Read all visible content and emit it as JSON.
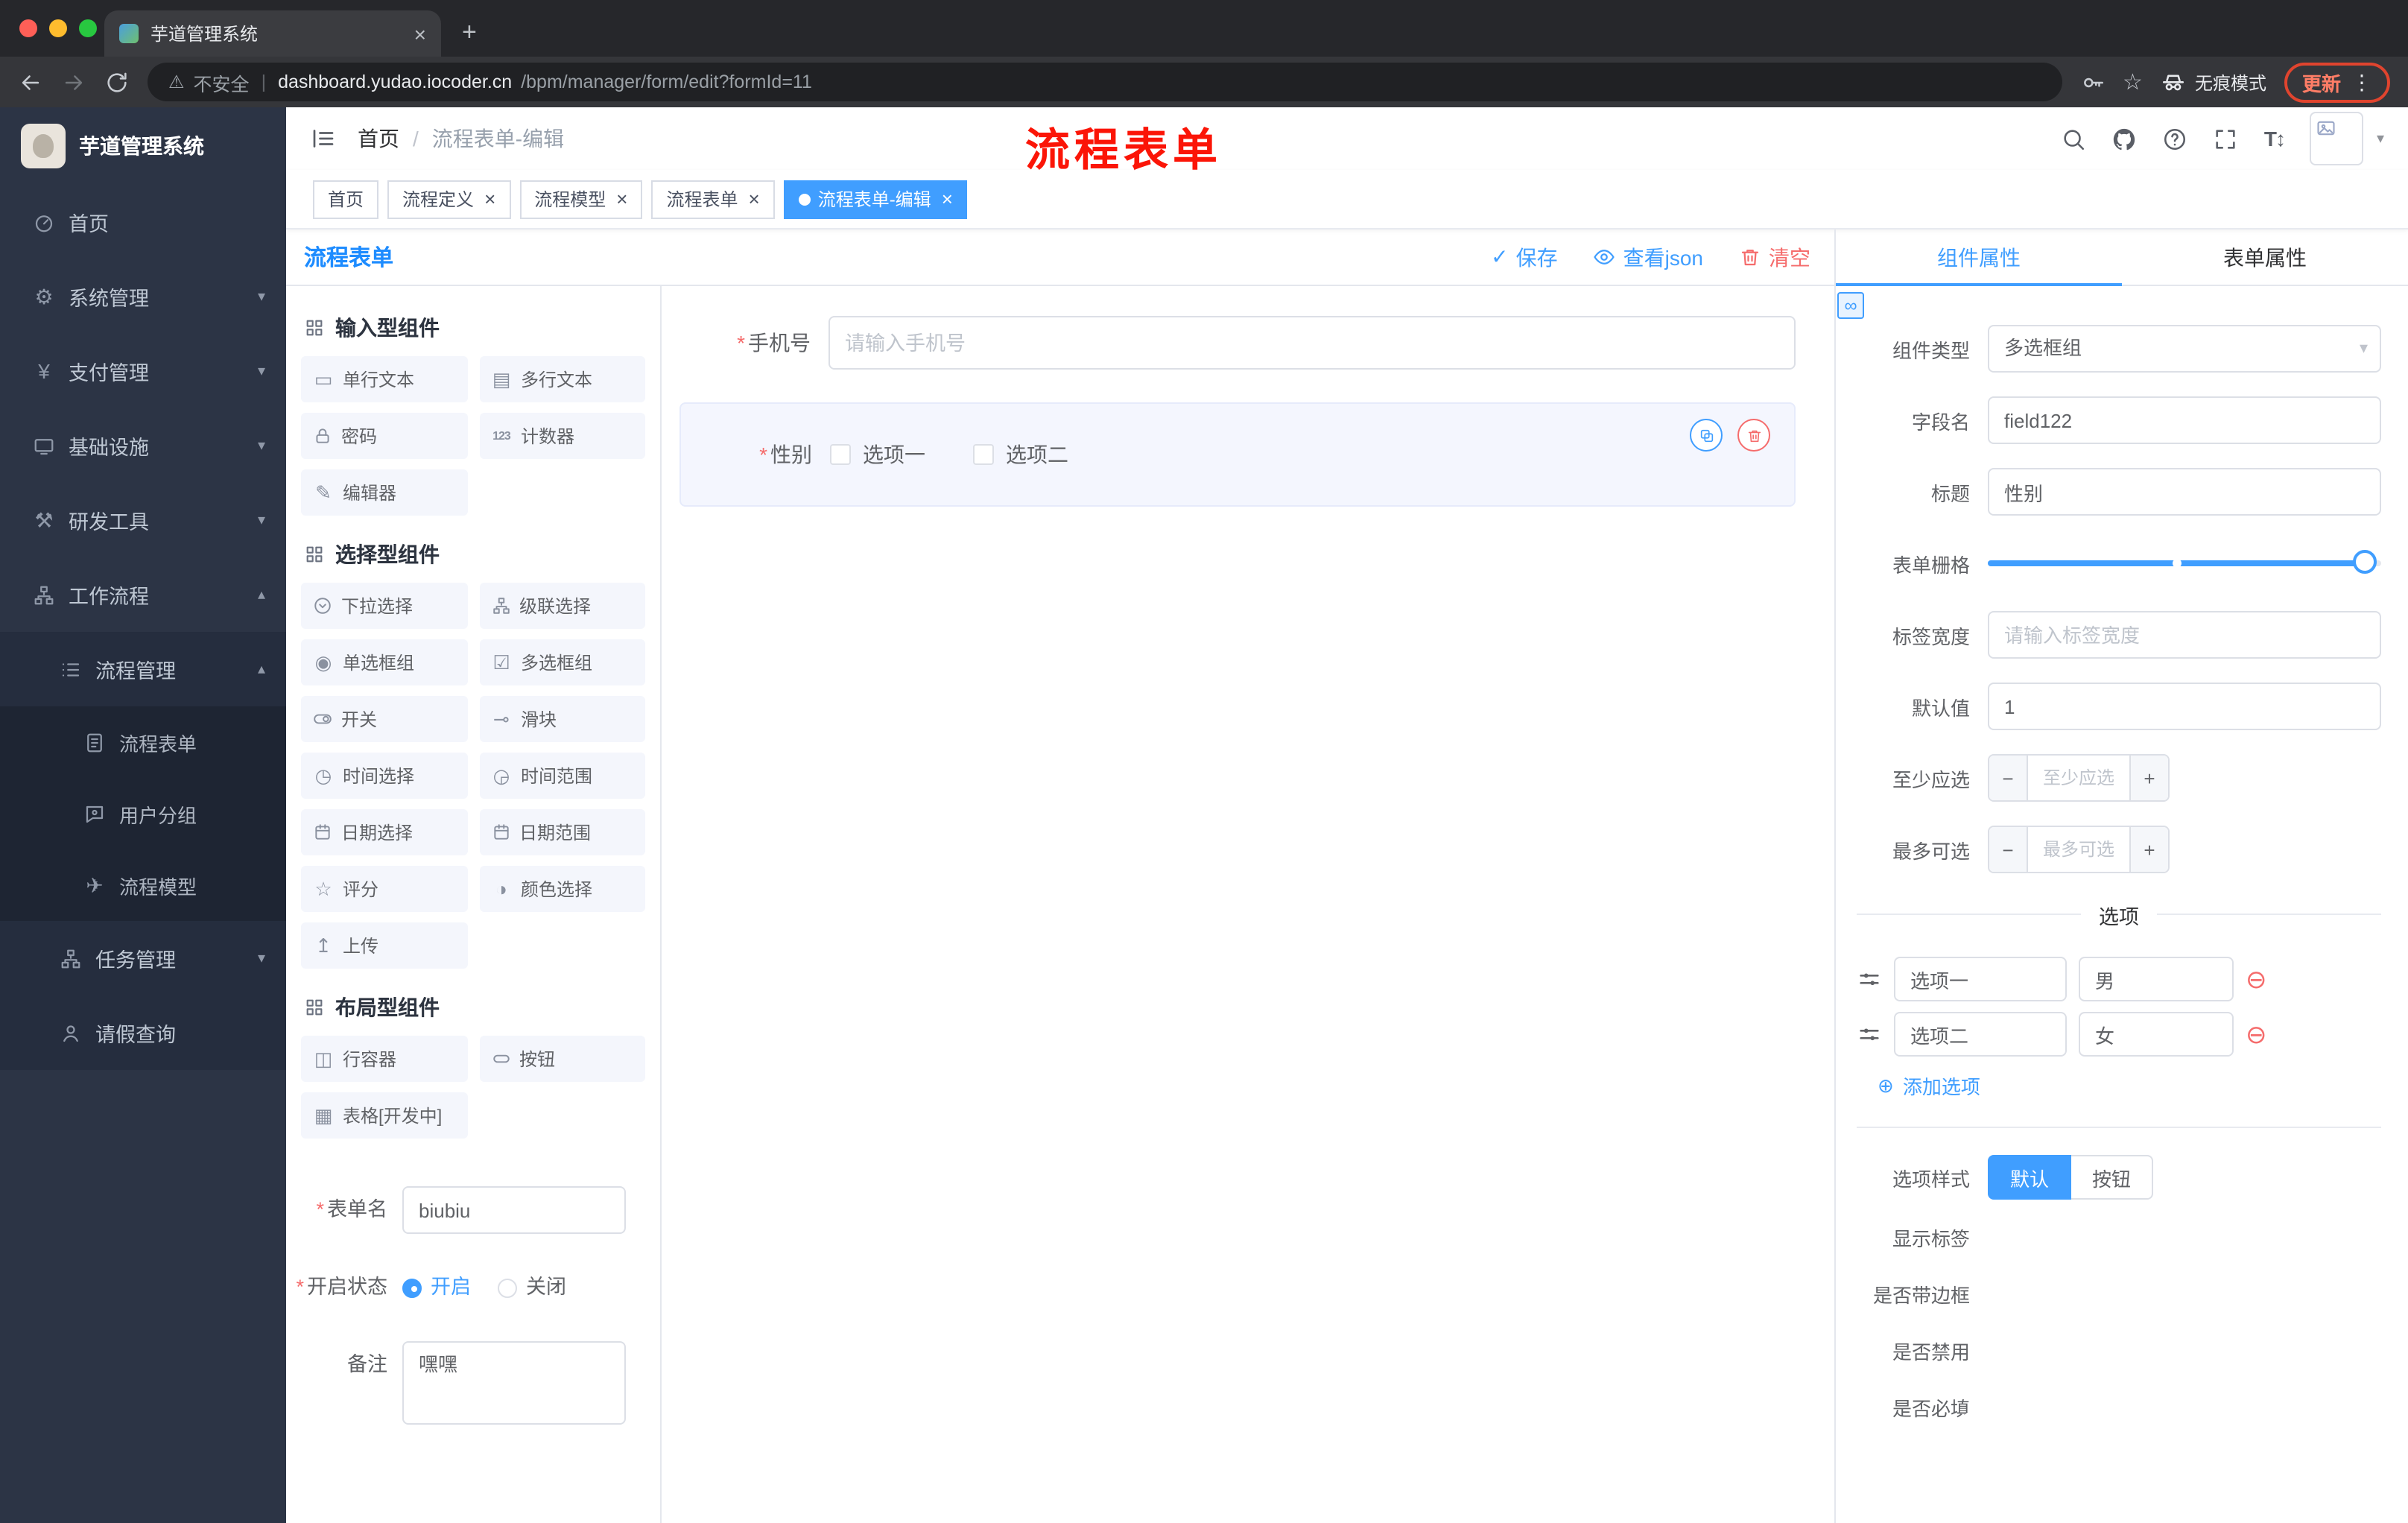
{
  "browser": {
    "tab_title": "芋道管理系统",
    "security_label": "不安全",
    "url_host": "dashboard.yudao.iocoder.cn",
    "url_path": "/bpm/manager/form/edit?formId=11",
    "incognito_label": "无痕模式",
    "update_label": "更新"
  },
  "annotation": {
    "overlay_title": "流程表单"
  },
  "icons": {
    "close": "×",
    "plus": "+",
    "more": "⋮",
    "warning": "⚠",
    "divider_bar": "|",
    "star": "☆",
    "caret_down": "▾",
    "caret_up": "▴",
    "breadcrumb_sep": "/",
    "asterisk": "*",
    "help": "?",
    "font_size": "T",
    "font_arrows": "↕",
    "check": "✓",
    "link": "∞",
    "minus": "−",
    "circle_minus": "⊖",
    "circle_plus": "⊕",
    "yen": "¥",
    "gear": "⚙",
    "tools": "⚒",
    "plane": "✈"
  },
  "sidebar": {
    "logo_title": "芋道管理系统",
    "items": {
      "home": "首页",
      "system": "系统管理",
      "pay": "支付管理",
      "infra": "基础设施",
      "dev": "研发工具",
      "workflow": "工作流程",
      "process_mgmt": "流程管理",
      "process_form": "流程表单",
      "user_group": "用户分组",
      "process_model": "流程模型",
      "task_mgmt": "任务管理",
      "leave_query": "请假查询"
    }
  },
  "header": {
    "breadcrumb_home": "首页",
    "breadcrumb_current": "流程表单-编辑"
  },
  "tags": [
    {
      "label": "首页"
    },
    {
      "label": "流程定义"
    },
    {
      "label": "流程模型"
    },
    {
      "label": "流程表单"
    },
    {
      "label": "流程表单-编辑"
    }
  ],
  "designer": {
    "title": "流程表单",
    "actions": {
      "save": "保存",
      "view_json": "查看json",
      "clear": "清空"
    },
    "palette": {
      "sections": [
        {
          "title": "输入型组件",
          "items": [
            {
              "label": "单行文本",
              "glyph": "▭"
            },
            {
              "label": "多行文本",
              "glyph": "▤"
            },
            {
              "label": "密码"
            },
            {
              "label": "计数器",
              "glyph": "123"
            },
            {
              "label": "编辑器",
              "glyph": "✎"
            }
          ]
        },
        {
          "title": "选择型组件",
          "items": [
            {
              "label": "下拉选择"
            },
            {
              "label": "级联选择"
            },
            {
              "label": "单选框组",
              "glyph": "◉"
            },
            {
              "label": "多选框组",
              "glyph": "☑"
            },
            {
              "label": "开关"
            },
            {
              "label": "滑块",
              "glyph": "⊸"
            },
            {
              "label": "时间选择",
              "glyph": "◷"
            },
            {
              "label": "时间范围",
              "glyph": "◶"
            },
            {
              "label": "日期选择"
            },
            {
              "label": "日期范围"
            },
            {
              "label": "评分",
              "glyph": "☆"
            },
            {
              "label": "颜色选择",
              "glyph": "◑"
            },
            {
              "label": "上传",
              "glyph": "↥"
            }
          ]
        },
        {
          "title": "布局型组件",
          "items": [
            {
              "label": "行容器",
              "glyph": "◫"
            },
            {
              "label": "按钮"
            },
            {
              "label": "表格[开发中]",
              "glyph": "▦"
            }
          ]
        }
      ]
    },
    "meta": {
      "form_name_label": "表单名",
      "form_name_value": "biubiu",
      "status_label": "开启状态",
      "status_on": "开启",
      "status_off": "关闭",
      "remark_label": "备注",
      "remark_value": "嘿嘿"
    },
    "canvas": {
      "phone_label": "手机号",
      "phone_placeholder": "请输入手机号",
      "gender_label": "性别",
      "gender_option1": "选项一",
      "gender_option2": "选项二"
    }
  },
  "properties": {
    "tab_component": "组件属性",
    "tab_form": "表单属性",
    "component_type_label": "组件类型",
    "component_type_value": "多选框组",
    "field_name_label": "字段名",
    "field_name_value": "field122",
    "title_label": "标题",
    "title_value": "性别",
    "grid_label": "表单栅格",
    "label_width_label": "标签宽度",
    "label_width_placeholder": "请输入标签宽度",
    "default_label": "默认值",
    "default_value": "1",
    "min_label": "至少应选",
    "min_placeholder": "至少应选",
    "max_label": "最多可选",
    "max_placeholder": "最多可选",
    "options_title": "选项",
    "options": [
      {
        "label": "选项一",
        "value": "男"
      },
      {
        "label": "选项二",
        "value": "女"
      }
    ],
    "add_option": "添加选项",
    "option_style_label": "选项样式",
    "style_default": "默认",
    "style_button": "按钮",
    "toggle_show_label": "显示标签",
    "toggle_border": "是否带边框",
    "toggle_disabled": "是否禁用",
    "toggle_required": "是否必填"
  }
}
